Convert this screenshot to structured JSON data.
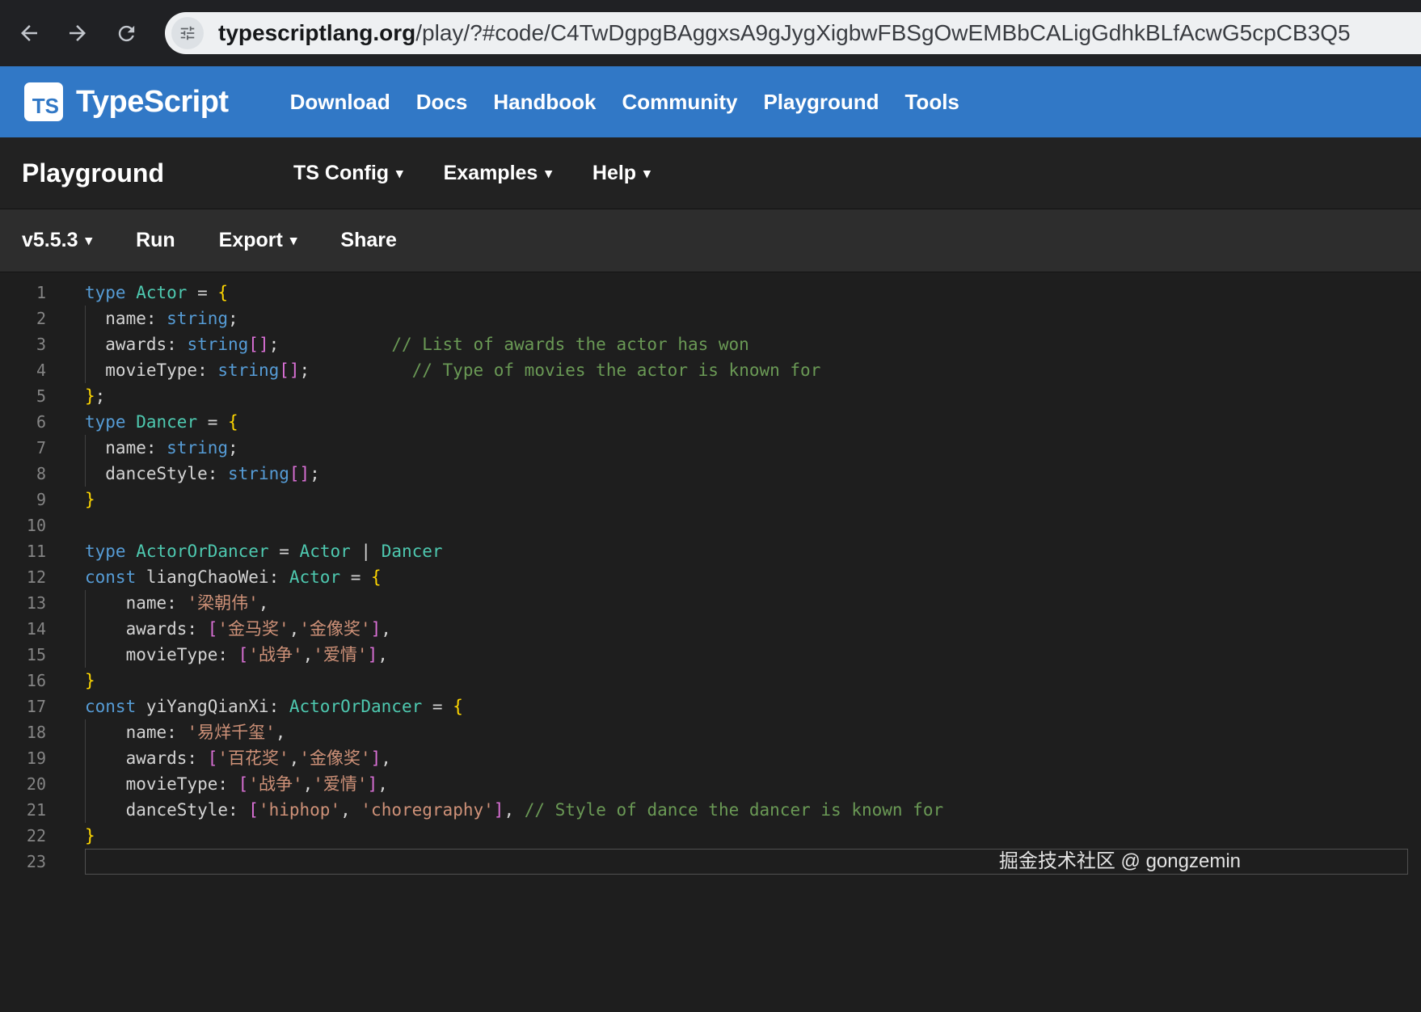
{
  "colors": {
    "header_blue": "#3178c6",
    "chrome_bg": "#202124",
    "omnibox_bg": "#eef0f2",
    "playground_bar_bg": "#222222",
    "toolbar_bg": "#2d2d2d",
    "editor_bg": "#1e1e1e"
  },
  "browser": {
    "url_domain": "typescriptlang.org",
    "url_rest": "/play/?#code/C4TwDgpgBAggxsA9gJygXigbwFBSgOwEMBbCALigGdhkBLfAcwG5cpCB3Q5"
  },
  "header": {
    "logo_text": "TS",
    "title": "TypeScript",
    "nav": [
      "Download",
      "Docs",
      "Handbook",
      "Community",
      "Playground",
      "Tools"
    ]
  },
  "playground_bar": {
    "title": "Playground",
    "menus": [
      {
        "label": "TS Config",
        "caret": true
      },
      {
        "label": "Examples",
        "caret": true
      },
      {
        "label": "Help",
        "caret": true
      }
    ]
  },
  "toolbar": {
    "items": [
      {
        "label": "v5.5.3",
        "caret": true
      },
      {
        "label": "Run",
        "caret": false
      },
      {
        "label": "Export",
        "caret": true
      },
      {
        "label": "Share",
        "caret": false
      }
    ]
  },
  "editor": {
    "watermark": "掘金技术社区 @ gongzemin",
    "token_colors": {
      "kw": "#569CD6",
      "typ": "#4EC9B0",
      "pln": "#D4D4D4",
      "str": "#CE9178",
      "com": "#6A9955",
      "b1": "#FFD700",
      "b2": "#DA70D6"
    },
    "lines": [
      {
        "n": 1,
        "t": [
          [
            "type",
            "kw"
          ],
          [
            " ",
            "pln"
          ],
          [
            "Actor",
            "typ"
          ],
          [
            " = ",
            "pln"
          ],
          [
            "{",
            "b1"
          ]
        ]
      },
      {
        "n": 2,
        "g": 1,
        "t": [
          [
            "  name: ",
            "pln"
          ],
          [
            "string",
            "kw"
          ],
          [
            ";",
            "pln"
          ]
        ]
      },
      {
        "n": 3,
        "g": 1,
        "t": [
          [
            "  awards: ",
            "pln"
          ],
          [
            "string",
            "kw"
          ],
          [
            "[]",
            "b2"
          ],
          [
            ";           ",
            "pln"
          ],
          [
            "// List of awards the actor has won",
            "com"
          ]
        ]
      },
      {
        "n": 4,
        "g": 1,
        "t": [
          [
            "  movieType: ",
            "pln"
          ],
          [
            "string",
            "kw"
          ],
          [
            "[]",
            "b2"
          ],
          [
            ";          ",
            "pln"
          ],
          [
            "// Type of movies the actor is known for",
            "com"
          ]
        ]
      },
      {
        "n": 5,
        "t": [
          [
            "}",
            "b1"
          ],
          [
            ";",
            "pln"
          ]
        ]
      },
      {
        "n": 6,
        "t": [
          [
            "type",
            "kw"
          ],
          [
            " ",
            "pln"
          ],
          [
            "Dancer",
            "typ"
          ],
          [
            " = ",
            "pln"
          ],
          [
            "{",
            "b1"
          ]
        ]
      },
      {
        "n": 7,
        "g": 1,
        "t": [
          [
            "  name: ",
            "pln"
          ],
          [
            "string",
            "kw"
          ],
          [
            ";",
            "pln"
          ]
        ]
      },
      {
        "n": 8,
        "g": 1,
        "t": [
          [
            "  danceStyle: ",
            "pln"
          ],
          [
            "string",
            "kw"
          ],
          [
            "[]",
            "b2"
          ],
          [
            ";",
            "pln"
          ]
        ]
      },
      {
        "n": 9,
        "t": [
          [
            "}",
            "b1"
          ]
        ]
      },
      {
        "n": 10,
        "t": []
      },
      {
        "n": 11,
        "t": [
          [
            "type",
            "kw"
          ],
          [
            " ",
            "pln"
          ],
          [
            "ActorOrDancer",
            "typ"
          ],
          [
            " = ",
            "pln"
          ],
          [
            "Actor",
            "typ"
          ],
          [
            " | ",
            "pln"
          ],
          [
            "Dancer",
            "typ"
          ]
        ]
      },
      {
        "n": 12,
        "t": [
          [
            "const",
            "kw"
          ],
          [
            " liangChaoWei: ",
            "pln"
          ],
          [
            "Actor",
            "typ"
          ],
          [
            " = ",
            "pln"
          ],
          [
            "{",
            "b1"
          ]
        ]
      },
      {
        "n": 13,
        "g": 1,
        "t": [
          [
            "    name: ",
            "pln"
          ],
          [
            "'梁朝伟'",
            "str"
          ],
          [
            ",",
            "pln"
          ]
        ]
      },
      {
        "n": 14,
        "g": 1,
        "t": [
          [
            "    awards: ",
            "pln"
          ],
          [
            "[",
            "b2"
          ],
          [
            "'金马奖'",
            "str"
          ],
          [
            ",",
            "pln"
          ],
          [
            "'金像奖'",
            "str"
          ],
          [
            "]",
            "b2"
          ],
          [
            ",",
            "pln"
          ]
        ]
      },
      {
        "n": 15,
        "g": 1,
        "t": [
          [
            "    movieType: ",
            "pln"
          ],
          [
            "[",
            "b2"
          ],
          [
            "'战争'",
            "str"
          ],
          [
            ",",
            "pln"
          ],
          [
            "'爱情'",
            "str"
          ],
          [
            "]",
            "b2"
          ],
          [
            ",",
            "pln"
          ]
        ]
      },
      {
        "n": 16,
        "t": [
          [
            "}",
            "b1"
          ]
        ]
      },
      {
        "n": 17,
        "t": [
          [
            "const",
            "kw"
          ],
          [
            " yiYangQianXi: ",
            "pln"
          ],
          [
            "ActorOrDancer",
            "typ"
          ],
          [
            " = ",
            "pln"
          ],
          [
            "{",
            "b1"
          ]
        ]
      },
      {
        "n": 18,
        "g": 1,
        "t": [
          [
            "    name: ",
            "pln"
          ],
          [
            "'易烊千玺'",
            "str"
          ],
          [
            ",",
            "pln"
          ]
        ]
      },
      {
        "n": 19,
        "g": 1,
        "t": [
          [
            "    awards: ",
            "pln"
          ],
          [
            "[",
            "b2"
          ],
          [
            "'百花奖'",
            "str"
          ],
          [
            ",",
            "pln"
          ],
          [
            "'金像奖'",
            "str"
          ],
          [
            "]",
            "b2"
          ],
          [
            ",",
            "pln"
          ]
        ]
      },
      {
        "n": 20,
        "g": 1,
        "t": [
          [
            "    movieType: ",
            "pln"
          ],
          [
            "[",
            "b2"
          ],
          [
            "'战争'",
            "str"
          ],
          [
            ",",
            "pln"
          ],
          [
            "'爱情'",
            "str"
          ],
          [
            "]",
            "b2"
          ],
          [
            ",",
            "pln"
          ]
        ]
      },
      {
        "n": 21,
        "g": 1,
        "t": [
          [
            "    danceStyle: ",
            "pln"
          ],
          [
            "[",
            "b2"
          ],
          [
            "'hiphop'",
            "str"
          ],
          [
            ", ",
            "pln"
          ],
          [
            "'choregraphy'",
            "str"
          ],
          [
            "]",
            "b2"
          ],
          [
            ", ",
            "pln"
          ],
          [
            "// Style of dance the dancer is known for",
            "com"
          ]
        ]
      },
      {
        "n": 22,
        "t": [
          [
            "}",
            "b1"
          ]
        ]
      },
      {
        "n": 23,
        "cur": 1,
        "t": []
      }
    ]
  }
}
